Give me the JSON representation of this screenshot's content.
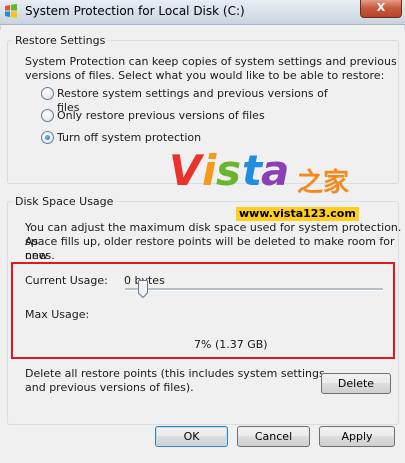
{
  "window": {
    "title": "System Protection for Local Disk (C:)",
    "close_label": "X"
  },
  "restore_settings": {
    "group_label": "Restore Settings",
    "description_line1": "System Protection can keep copies of system settings and previous",
    "description_line2": "versions of files. Select what you would like to be able to restore:",
    "options": [
      {
        "label": "Restore system settings and previous versions of files",
        "checked": false
      },
      {
        "label": "Only restore previous versions of files",
        "checked": false
      },
      {
        "label": "Turn off system protection",
        "checked": true
      }
    ]
  },
  "disk_space": {
    "group_label": "Disk Space Usage",
    "description_line1": "You can adjust the maximum disk space used for system protection. As",
    "description_line2": "space fills up, older restore points will be deleted to make room for new",
    "description_line3": "ones.",
    "current_usage_label": "Current Usage:",
    "current_usage_value": "0 bytes",
    "max_usage_label": "Max Usage:",
    "max_usage_value": "7% (1.37 GB)",
    "slider_percent": 7
  },
  "delete_section": {
    "text_line1": "Delete all restore points (this includes system settings",
    "text_line2": "and previous versions of files).",
    "delete_label": "Delete"
  },
  "footer": {
    "ok_label": "OK",
    "cancel_label": "Cancel",
    "apply_label": "Apply"
  },
  "watermark": {
    "letters": [
      "V",
      "i",
      "s",
      "t",
      "a"
    ],
    "letter_colors": [
      "#e8322a",
      "#f59a1a",
      "#6bb42d",
      "#1f8de0",
      "#8a3fb5"
    ],
    "cjk": "之家",
    "url": "www.vista123.com"
  }
}
